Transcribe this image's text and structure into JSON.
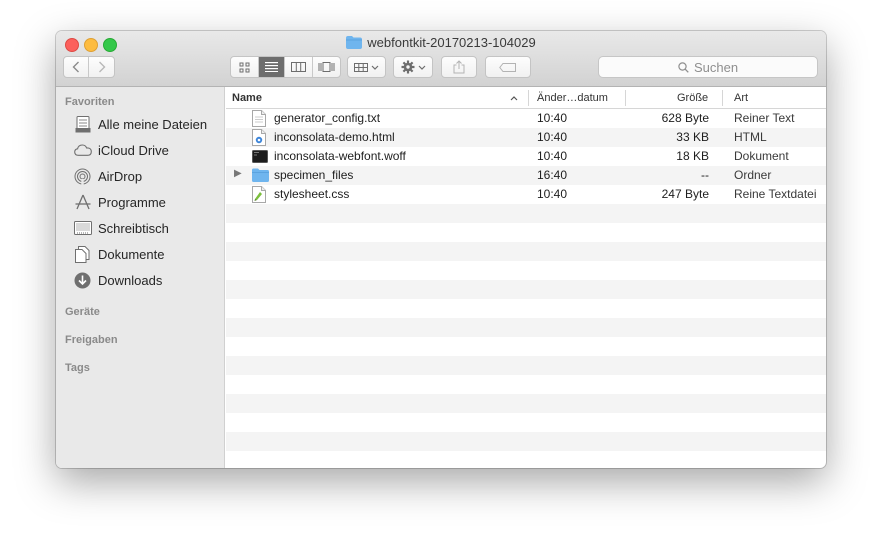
{
  "window": {
    "title": "webfontkit-20170213-104029"
  },
  "toolbar": {
    "view_modes": [
      "icon-view",
      "list-view",
      "column-view",
      "coverflow-view"
    ],
    "search_placeholder": "Suchen"
  },
  "sidebar": {
    "favorites_header": "Favoriten",
    "items": [
      {
        "label": "Alle meine Dateien",
        "icon": "all-files-icon"
      },
      {
        "label": "iCloud Drive",
        "icon": "cloud-icon"
      },
      {
        "label": "AirDrop",
        "icon": "airdrop-icon"
      },
      {
        "label": "Programme",
        "icon": "applications-icon"
      },
      {
        "label": "Schreibtisch",
        "icon": "desktop-icon"
      },
      {
        "label": "Dokumente",
        "icon": "documents-icon"
      },
      {
        "label": "Downloads",
        "icon": "downloads-icon"
      }
    ],
    "devices_header": "Geräte",
    "shared_header": "Freigaben",
    "tags_header": "Tags"
  },
  "columns": {
    "name": "Name",
    "date": "Änder…datum",
    "size": "Größe",
    "kind": "Art"
  },
  "files": [
    {
      "name": "generator_config.txt",
      "date": "10:40",
      "size": "628 Byte",
      "kind": "Reiner Text",
      "icon": "text-file-icon"
    },
    {
      "name": "inconsolata-demo.html",
      "date": "10:40",
      "size": "33 KB",
      "kind": "HTML",
      "icon": "html-file-icon"
    },
    {
      "name": "inconsolata-webfont.woff",
      "date": "10:40",
      "size": "18 KB",
      "kind": "Dokument",
      "icon": "woff-file-icon"
    },
    {
      "name": "specimen_files",
      "date": "16:40",
      "size": "--",
      "kind": "Ordner",
      "icon": "folder-icon"
    },
    {
      "name": "stylesheet.css",
      "date": "10:40",
      "size": "247 Byte",
      "kind": "Reine Textdatei",
      "icon": "css-file-icon"
    }
  ],
  "colors": {
    "folder": "#6fb5ee",
    "sidebar_bg": "#e9e9e9",
    "close": "#fc605c",
    "minimize": "#fdbc40",
    "zoom": "#34c84a"
  }
}
